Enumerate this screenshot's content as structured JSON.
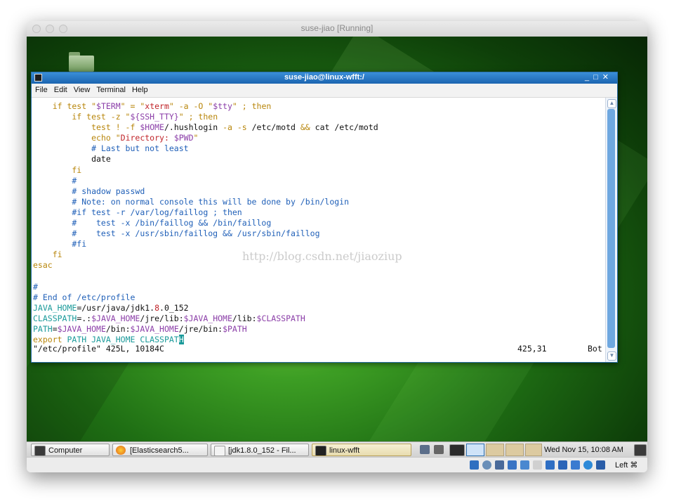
{
  "vbox": {
    "title": "suse-jiao [Running]"
  },
  "terminal": {
    "title": "suse-jiao@linux-wfft:/",
    "menu": [
      "File",
      "Edit",
      "View",
      "Terminal",
      "Help"
    ],
    "status_left": "\"/etc/profile\" 425L, 10184C",
    "position": "425,31",
    "scroll": "Bot"
  },
  "watermark": "http://blog.csdn.net/jiaoziup",
  "taskbar": {
    "items": [
      {
        "label": "Computer"
      },
      {
        "label": "[Elasticsearch5..."
      },
      {
        "label": "[jdk1.8.0_152 - Fil..."
      },
      {
        "label": "linux-wfft"
      }
    ],
    "clock": "Wed Nov 15, 10:08 AM"
  },
  "host_key": "Left ⌘",
  "colors": {
    "title_blue": "#1b64b0",
    "comment": "#2060b8",
    "keyword": "#b8860b",
    "string": "#c0252a",
    "variable": "#8b3ea8",
    "export": "#1a9a9a"
  },
  "icons": [
    "folder-icon",
    "terminal-icon",
    "computer-icon",
    "firefox-icon",
    "file-manager-icon",
    "network-icon",
    "volume-icon",
    "display-icon"
  ]
}
